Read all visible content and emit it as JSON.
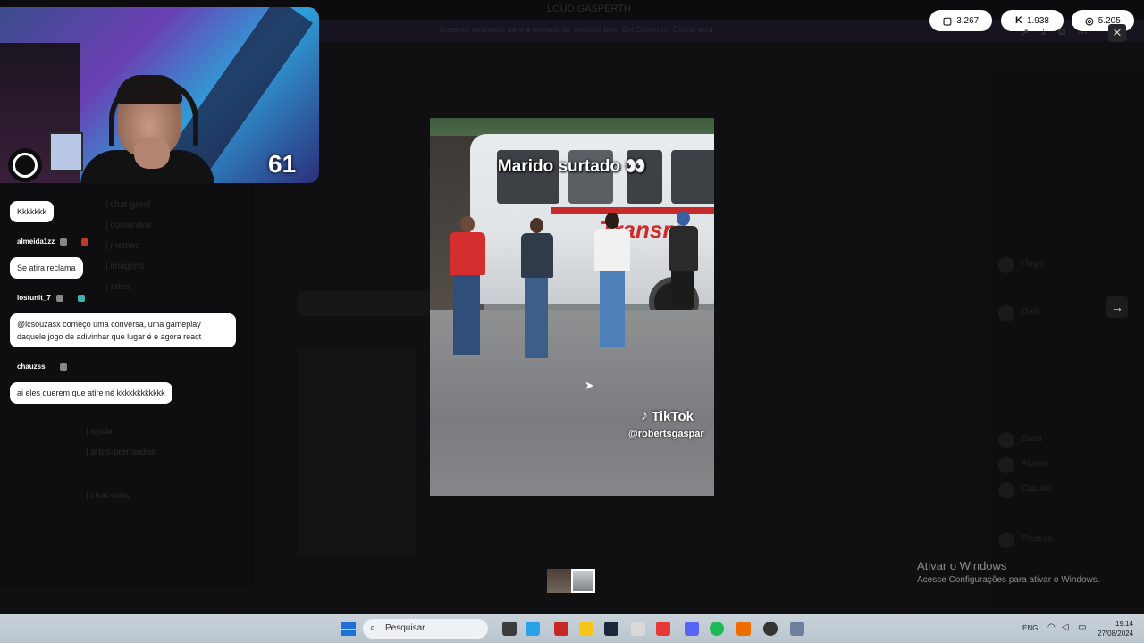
{
  "background_app": {
    "title": "LOUD GASPERTH",
    "banner": "Boas no aplicativo para a entrada de servidor pelo Bot Commun. Clique aqui",
    "channels": [
      "| chat-geral",
      "| comandos",
      "| memes",
      "| imagens",
      "| artes",
      "| ajuda",
      "| artes-premiadas",
      "| chat-subs"
    ],
    "members": [
      "Hugo",
      "Dark",
      "Brisa",
      "Alpaca",
      "Claudio",
      "Picasso"
    ]
  },
  "webcam": {
    "counter": "61"
  },
  "chat": {
    "messages": [
      {
        "user": "",
        "text": "Kkkkkkk"
      },
      {
        "user": "almeida1zz",
        "text": "Se atira reclama"
      },
      {
        "user": "lostunit_7",
        "text": "@lcsouzasx começo uma conversa, uma gameplay daquele jogo de adivinhar que lugar é e agora react"
      },
      {
        "user": "chauzss",
        "text": "ai eles querem que atire né kkkkkkkkkkkk"
      }
    ]
  },
  "stats": {
    "twitch": "3.267",
    "kick": "1.938",
    "web": "5.205"
  },
  "video": {
    "caption": "Marido surtado 👀",
    "tiktok_label": "TikTok",
    "handle": "@robertsgaspar",
    "bus_brand": "Transm"
  },
  "activate_windows": {
    "title": "Ativar o Windows",
    "subtitle": "Acesse Configurações para ativar o Windows."
  },
  "taskbar": {
    "search_placeholder": "Pesquisar",
    "lang": "ENG",
    "time": "19:14",
    "date": "27/08/2024"
  },
  "colors": {
    "bus_stripe": "#c72a2a",
    "start_blue": "#1e6fd6"
  }
}
